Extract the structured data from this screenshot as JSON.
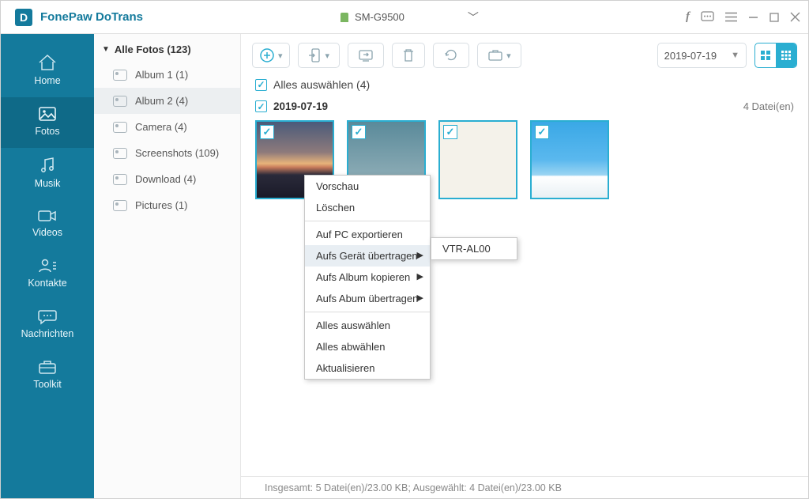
{
  "titlebar": {
    "logo_letter": "D",
    "app_title": "FonePaw DoTrans",
    "device_name": "SM-G9500"
  },
  "nav": {
    "items": [
      {
        "label": "Home"
      },
      {
        "label": "Fotos"
      },
      {
        "label": "Musik"
      },
      {
        "label": "Videos"
      },
      {
        "label": "Kontakte"
      },
      {
        "label": "Nachrichten"
      },
      {
        "label": "Toolkit"
      }
    ]
  },
  "albums": {
    "header": "Alle Fotos (123)",
    "items": [
      {
        "label": "Album 1 (1)"
      },
      {
        "label": "Album 2 (4)"
      },
      {
        "label": "Camera (4)"
      },
      {
        "label": "Screenshots (109)"
      },
      {
        "label": "Download (4)"
      },
      {
        "label": "Pictures (1)"
      }
    ]
  },
  "toolbar": {
    "date": "2019-07-19"
  },
  "main": {
    "select_all_label": "Alles auswählen (4)",
    "group_date": "2019-07-19",
    "group_count": "4 Datei(en)"
  },
  "context_menu": {
    "items": [
      "Vorschau",
      "Löschen",
      "Auf PC exportieren",
      "Aufs Gerät übertragen",
      "Aufs Album kopieren",
      "Aufs Abum übertragen",
      "Alles auswählen",
      "Alles abwählen",
      "Aktualisieren"
    ],
    "submenu": [
      "VTR-AL00"
    ]
  },
  "status": {
    "text": "Insgesamt: 5 Datei(en)/23.00 KB; Ausgewählt: 4 Datei(en)/23.00 KB"
  }
}
